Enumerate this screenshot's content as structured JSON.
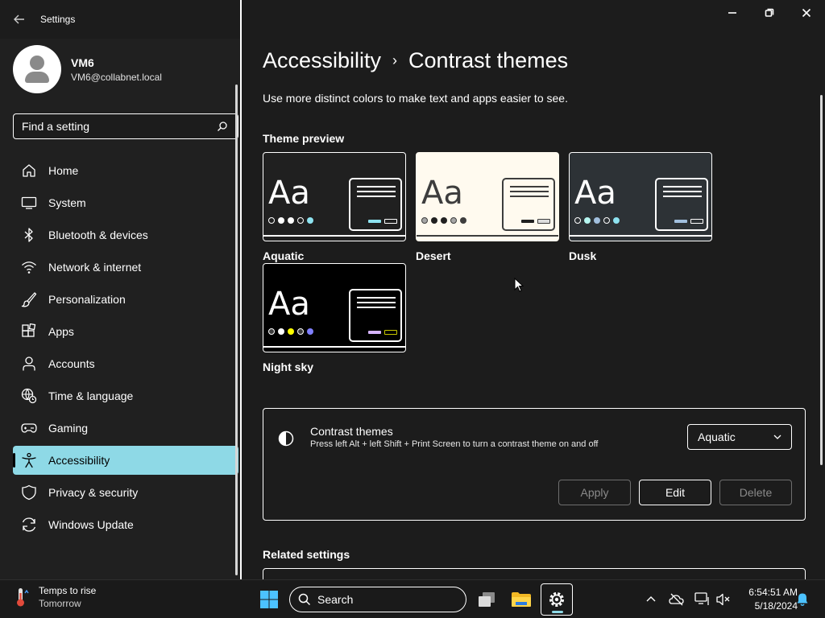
{
  "app": {
    "title": "Settings"
  },
  "profile": {
    "name": "VM6",
    "email": "VM6@collabnet.local"
  },
  "search": {
    "placeholder": "Find a setting"
  },
  "nav": {
    "items": [
      {
        "label": "Home",
        "icon": "home-icon"
      },
      {
        "label": "System",
        "icon": "monitor-icon"
      },
      {
        "label": "Bluetooth & devices",
        "icon": "bluetooth-icon"
      },
      {
        "label": "Network & internet",
        "icon": "wifi-icon"
      },
      {
        "label": "Personalization",
        "icon": "brush-icon"
      },
      {
        "label": "Apps",
        "icon": "apps-icon"
      },
      {
        "label": "Accounts",
        "icon": "person-icon"
      },
      {
        "label": "Time & language",
        "icon": "globe-clock-icon"
      },
      {
        "label": "Gaming",
        "icon": "gamepad-icon"
      },
      {
        "label": "Accessibility",
        "icon": "accessibility-icon",
        "active": true
      },
      {
        "label": "Privacy & security",
        "icon": "shield-icon"
      },
      {
        "label": "Windows Update",
        "icon": "update-icon"
      }
    ]
  },
  "breadcrumb": {
    "parent": "Accessibility",
    "separator": "›",
    "current": "Contrast themes"
  },
  "description": "Use more distinct colors to make text and apps easier to see.",
  "theme_preview": {
    "label": "Theme preview",
    "themes": [
      {
        "name": "Aquatic",
        "bg": "#202020",
        "fg": "#ffffff",
        "accent": "#8ee3f0",
        "dots": [
          "#202020",
          "#ffffff",
          "#ffffff",
          "#202020",
          "#8ee3f0"
        ]
      },
      {
        "name": "Desert",
        "bg": "#fffaef",
        "fg": "#3d3d3d",
        "accent": "#202020",
        "dots": [
          "#a6a6a6",
          "#202020",
          "#202020",
          "#a6a6a6",
          "#3d3d3d"
        ]
      },
      {
        "name": "Dusk",
        "bg": "#2d3236",
        "fg": "#ffffff",
        "accent": "#a1bfde",
        "dots": [
          "#2d3236",
          "#b6f6f0",
          "#a1bfde",
          "#2d3236",
          "#8ee3f0"
        ]
      },
      {
        "name": "Night sky",
        "bg": "#000000",
        "fg": "#ffffff",
        "accent": "#d6b4fd",
        "dots": [
          "#3d3d3d",
          "#ffffff",
          "#ffff00",
          "#3d3d3d",
          "#8080ff"
        ]
      }
    ]
  },
  "contrast_setting": {
    "title": "Contrast themes",
    "subtitle": "Press left Alt + left Shift + Print Screen to turn a contrast theme on and off",
    "selected": "Aquatic",
    "apply_label": "Apply",
    "edit_label": "Edit",
    "delete_label": "Delete"
  },
  "related": {
    "label": "Related settings"
  },
  "taskbar": {
    "weather_title": "Temps to rise",
    "weather_sub": "Tomorrow",
    "search_placeholder": "Search",
    "time": "6:54:51 AM",
    "date": "5/18/2024"
  },
  "colors": {
    "background": "#1c1c1c",
    "sidebar": "#202020",
    "accent": "#8ed9e6"
  }
}
